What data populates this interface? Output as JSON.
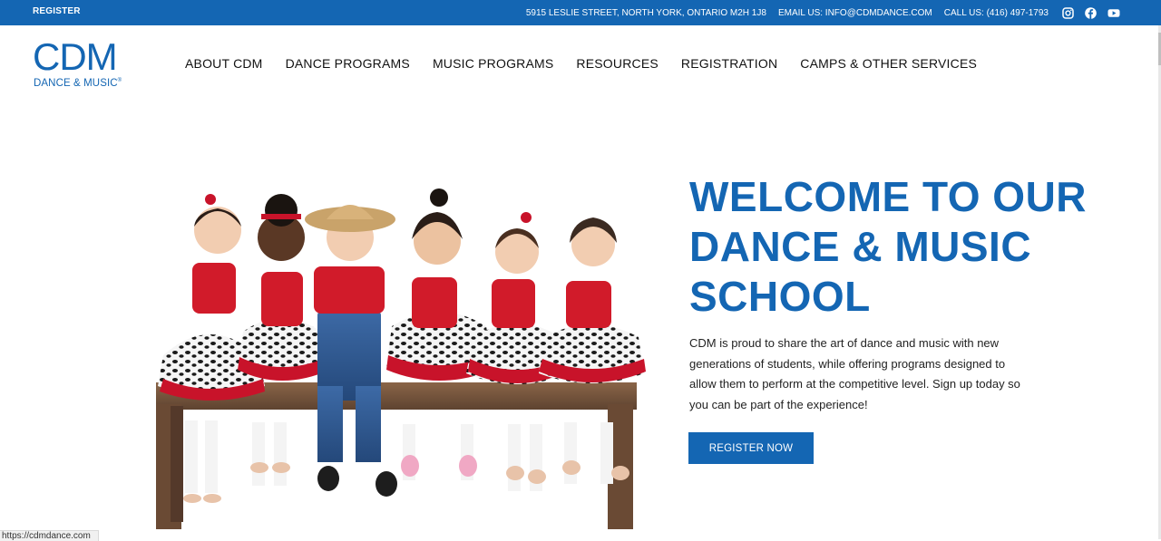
{
  "colors": {
    "brand": "#1466b3"
  },
  "topbar": {
    "register_label": "REGISTER",
    "address": "5915 LESLIE STREET, NORTH YORK, ONTARIO M2H 1J8",
    "email": "EMAIL US: INFO@CDMDANCE.COM",
    "phone": "CALL US: (416) 497-1793",
    "social": [
      "instagram-icon",
      "facebook-icon",
      "youtube-icon"
    ]
  },
  "header": {
    "logo_main": "CDM",
    "logo_sub": "DANCE & MUSIC",
    "logo_mark": "®",
    "nav": [
      "ABOUT CDM",
      "DANCE PROGRAMS",
      "MUSIC PROGRAMS",
      "RESOURCES",
      "REGISTRATION",
      "CAMPS & OTHER SERVICES"
    ]
  },
  "hero": {
    "headline_lines": [
      "WELCOME TO OUR",
      "DANCE & MUSIC",
      "SCHOOL"
    ],
    "intro_lines": [
      "CDM is proud to share the art of dance and music with new",
      "generations of students, while offering programs designed to",
      "allow them to perform at the competitive level. Sign up today so",
      "you can be part of the experience!"
    ],
    "cta_label": "REGISTER NOW"
  },
  "statusbar": {
    "url": "https://cdmdance.com"
  }
}
